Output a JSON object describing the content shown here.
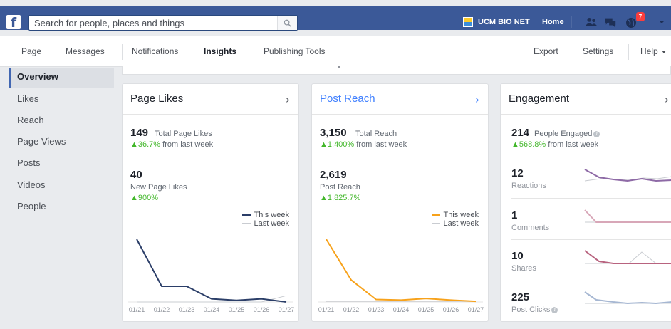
{
  "topbar": {
    "search_placeholder": "Search for people, places and things",
    "page_name": "UCM BIO NET",
    "home_label": "Home",
    "notification_count": "7"
  },
  "subnav": {
    "page": "Page",
    "messages": "Messages",
    "notifications": "Notifications",
    "insights": "Insights",
    "publishing_tools": "Publishing Tools",
    "export": "Export",
    "settings": "Settings",
    "help": "Help"
  },
  "sidebar": {
    "items": [
      {
        "label": "Overview"
      },
      {
        "label": "Likes"
      },
      {
        "label": "Reach"
      },
      {
        "label": "Page Views"
      },
      {
        "label": "Posts"
      },
      {
        "label": "Videos"
      },
      {
        "label": "People"
      }
    ]
  },
  "colors": {
    "brand": "#3b5998",
    "link": "#4080ff",
    "positive": "#42b72a",
    "likes_this_week": "#2b3e68",
    "reach_this_week": "#f7a21b",
    "last_week": "#c9ccd1"
  },
  "cards": {
    "likes": {
      "title": "Page Likes",
      "total": "149",
      "total_label": "Total Page Likes",
      "total_change": "36.7%",
      "total_change_suffix": "from last week",
      "new": "40",
      "new_label": "New Page Likes",
      "new_change": "900%",
      "legend_this": "This week",
      "legend_last": "Last week"
    },
    "reach": {
      "title": "Post Reach",
      "total": "3,150",
      "total_label": "Total Reach",
      "total_change": "1,400%",
      "total_change_suffix": "from last week",
      "post": "2,619",
      "post_label": "Post Reach",
      "post_change": "1,825.7%",
      "legend_this": "This week",
      "legend_last": "Last week"
    },
    "engagement": {
      "title": "Engagement",
      "total": "214",
      "total_label": "People Engaged",
      "total_change": "568.8%",
      "total_change_suffix": "from last week",
      "rows": [
        {
          "value": "12",
          "label": "Reactions"
        },
        {
          "value": "1",
          "label": "Comments"
        },
        {
          "value": "10",
          "label": "Shares"
        },
        {
          "value": "225",
          "label": "Post Clicks"
        }
      ]
    }
  },
  "chart_data": [
    {
      "type": "line",
      "x": [
        "01/21",
        "01/22",
        "01/23",
        "01/24",
        "01/25",
        "01/26",
        "01/27"
      ],
      "series": [
        {
          "name": "This week",
          "values": [
            40,
            10,
            10,
            2,
            1,
            2,
            0
          ]
        },
        {
          "name": "Last week",
          "values": [
            0,
            0,
            0,
            0,
            0,
            0,
            4
          ]
        }
      ]
    },
    {
      "type": "line",
      "x": [
        "01/21",
        "01/22",
        "01/23",
        "01/24",
        "01/25",
        "01/26",
        "01/27"
      ],
      "series": [
        {
          "name": "This week",
          "values": [
            2000,
            700,
            80,
            60,
            110,
            60,
            20
          ]
        },
        {
          "name": "Last week",
          "values": [
            20,
            20,
            20,
            20,
            20,
            20,
            20
          ]
        }
      ]
    }
  ]
}
